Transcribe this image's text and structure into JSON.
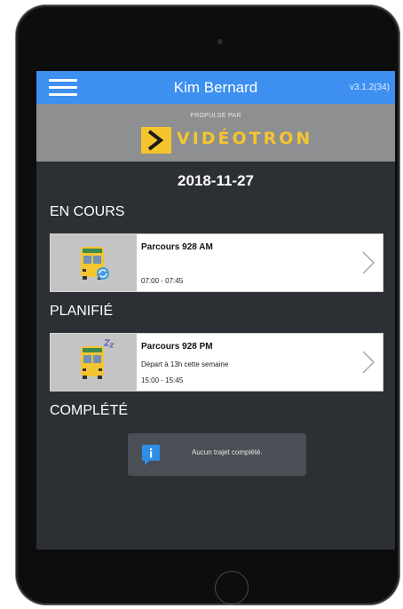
{
  "app": {
    "user_name": "Kim Bernard",
    "version": "v3.1.2(34)",
    "powered_by": "PROPULSÉ PAR",
    "brand_name": "VIDÉOTRON",
    "date": "2018-11-27"
  },
  "sections": {
    "in_progress": "EN COURS",
    "planned": "PLANIFIÉ",
    "completed": "COMPLÉTÉ"
  },
  "routes": {
    "in_progress": {
      "title": "Parcours 928 AM",
      "subtitle": "",
      "time": "07:00 - 07:45",
      "icon": "bus-syncing-icon"
    },
    "planned": {
      "title": "Parcours 928 PM",
      "subtitle": "Départ à 13h cette semaine",
      "time": "15:00 - 15:45",
      "icon": "bus-sleeping-icon"
    }
  },
  "completed_empty": {
    "message": "Aucun trajet complété.",
    "icon": "info-icon"
  },
  "colors": {
    "topbar": "#3d8ff0",
    "background": "#2c2f33",
    "brand_yellow": "#f6c52e",
    "brand_band": "#8d8f91"
  }
}
